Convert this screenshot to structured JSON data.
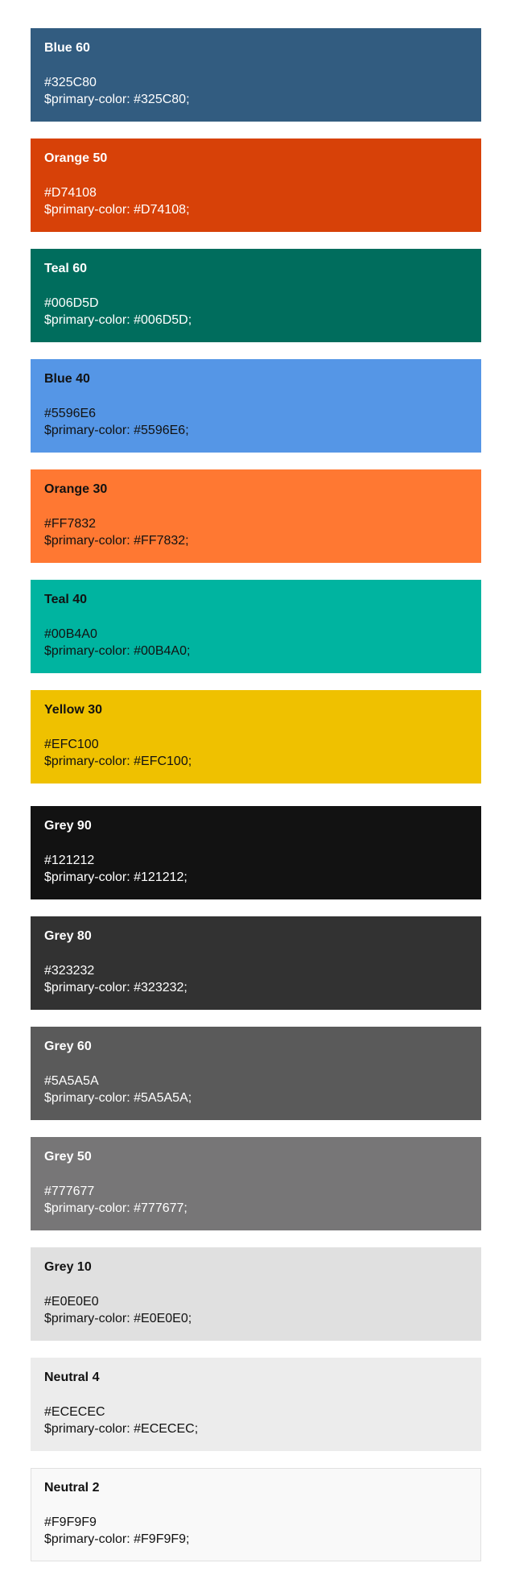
{
  "swatches": [
    {
      "name": "Blue 60",
      "hex": "#325C80",
      "variable": "$primary-color: #325C80;",
      "color": "#325C80",
      "text": "light"
    },
    {
      "name": "Orange 50",
      "hex": "#D74108",
      "variable": "$primary-color: #D74108;",
      "color": "#D74108",
      "text": "light"
    },
    {
      "name": "Teal 60",
      "hex": "#006D5D",
      "variable": "$primary-color: #006D5D;",
      "color": "#006D5D",
      "text": "light"
    },
    {
      "name": "Blue 40",
      "hex": "#5596E6",
      "variable": "$primary-color: #5596E6;",
      "color": "#5596E6",
      "text": "dark"
    },
    {
      "name": "Orange 30",
      "hex": "#FF7832",
      "variable": "$primary-color: #FF7832;",
      "color": "#FF7832",
      "text": "dark"
    },
    {
      "name": "Teal 40",
      "hex": "#00B4A0",
      "variable": "$primary-color: #00B4A0;",
      "color": "#00B4A0",
      "text": "dark"
    },
    {
      "name": "Yellow 30",
      "hex": "#EFC100",
      "variable": "$primary-color: #EFC100;",
      "color": "#EFC100",
      "text": "dark"
    },
    {
      "name": "Grey 90",
      "hex": "#121212",
      "variable": "$primary-color: #121212;",
      "color": "#121212",
      "text": "light"
    },
    {
      "name": "Grey 80",
      "hex": "#323232",
      "variable": "$primary-color: #323232;",
      "color": "#323232",
      "text": "light"
    },
    {
      "name": "Grey 60",
      "hex": "#5A5A5A",
      "variable": "$primary-color: #5A5A5A;",
      "color": "#5A5A5A",
      "text": "light"
    },
    {
      "name": "Grey 50",
      "hex": "#777677",
      "variable": "$primary-color: #777677;",
      "color": "#777677",
      "text": "light"
    },
    {
      "name": "Grey 10",
      "hex": "#E0E0E0",
      "variable": "$primary-color: #E0E0E0;",
      "color": "#E0E0E0",
      "text": "dark"
    },
    {
      "name": "Neutral 4",
      "hex": "#ECECEC",
      "variable": "$primary-color: #ECECEC;",
      "color": "#ECECEC",
      "text": "dark"
    },
    {
      "name": "Neutral 2",
      "hex": "#F9F9F9",
      "variable": "$primary-color: #F9F9F9;",
      "color": "#F9F9F9",
      "text": "dark"
    }
  ]
}
